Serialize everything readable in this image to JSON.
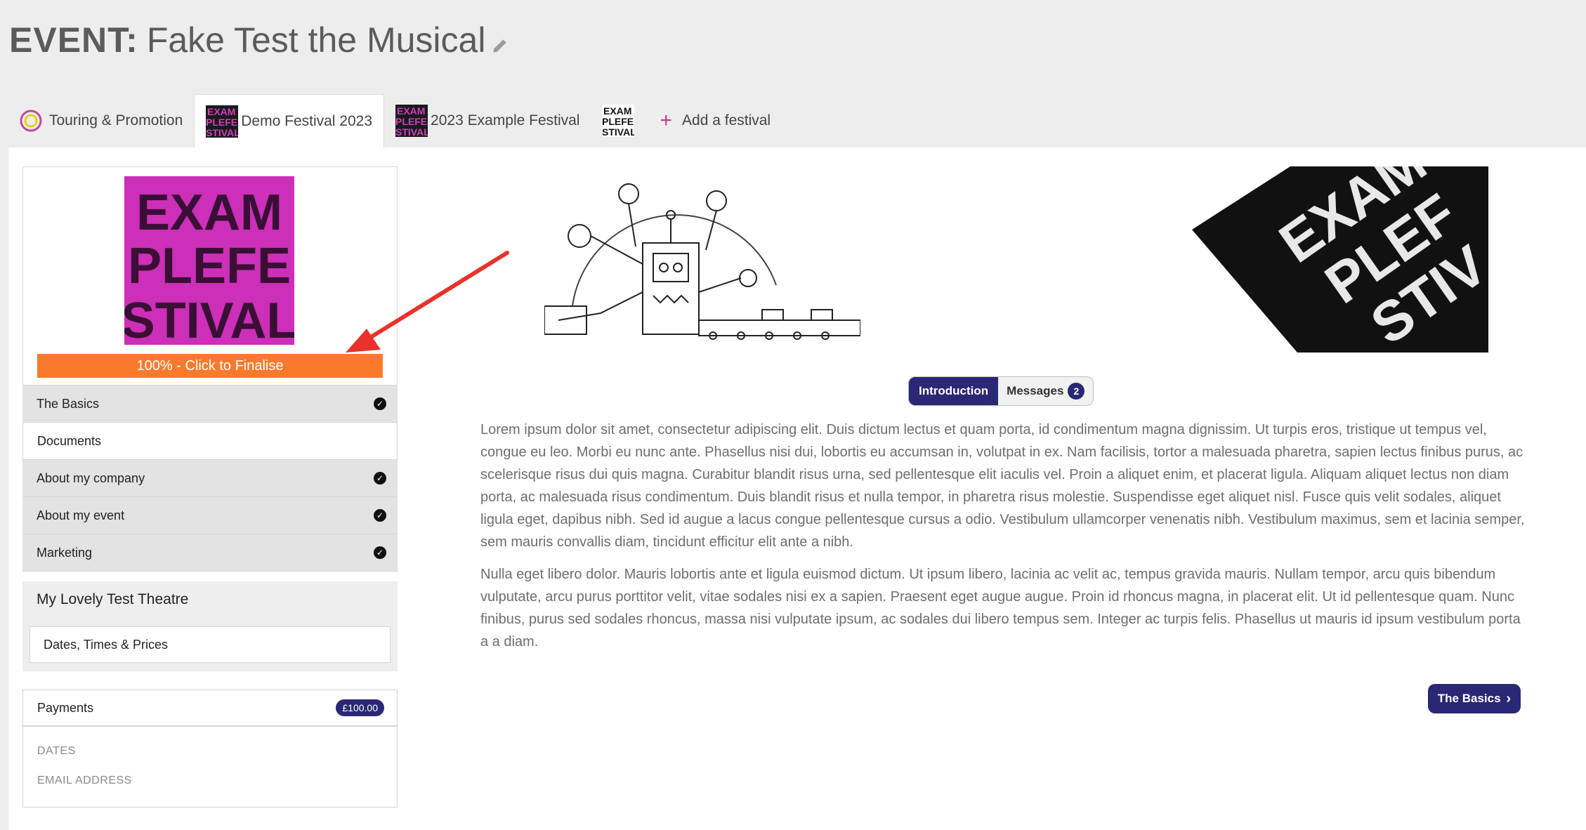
{
  "header": {
    "label": "EVENT:",
    "event_name": "Fake Test the Musical"
  },
  "tabs": [
    {
      "label": "Touring & Promotion",
      "icon": "ring-icon"
    },
    {
      "label": "Demo Festival 2023",
      "icon": "festival-logo-icon",
      "active": true
    },
    {
      "label": "2023 Example Festival",
      "icon": "festival-logo-icon"
    },
    {
      "label": "",
      "icon": "festival-logo-bw-icon"
    },
    {
      "label": "Add a festival",
      "icon": "plus-icon"
    }
  ],
  "sidebar": {
    "logo_text": [
      "EXAM",
      "PLEFE",
      "STIVAL"
    ],
    "progress": {
      "percent": 100,
      "label": "100% - Click to Finalise"
    },
    "menu": [
      {
        "label": "The Basics",
        "complete": true
      },
      {
        "label": "Documents",
        "complete": false
      },
      {
        "label": "About my company",
        "complete": true
      },
      {
        "label": "About my event",
        "complete": true
      },
      {
        "label": "Marketing",
        "complete": true
      }
    ],
    "venue": {
      "title": "My Lovely Test Theatre",
      "button": "Dates, Times & Prices"
    },
    "payments": {
      "label": "Payments",
      "amount": "£100.00",
      "fields": [
        "DATES",
        "EMAIL ADDRESS"
      ]
    }
  },
  "main": {
    "segment": {
      "intro": "Introduction",
      "messages": "Messages",
      "message_count": "2"
    },
    "paragraphs": [
      "Lorem ipsum dolor sit amet, consectetur adipiscing elit. Duis dictum lectus et quam porta, id condimentum magna dignissim. Ut turpis eros, tristique ut tempus vel, congue eu leo. Morbi eu nunc ante. Phasellus nisi dui, lobortis eu accumsan in, volutpat in ex. Nam facilisis, tortor a malesuada pharetra, sapien lectus finibus purus, ac scelerisque risus dui quis magna. Curabitur blandit risus urna, sed pellentesque elit iaculis vel. Proin a aliquet enim, et placerat ligula. Aliquam aliquet lectus non diam porta, ac malesuada risus condimentum. Duis blandit risus et nulla tempor, in pharetra risus molestie. Suspendisse eget aliquet nisl. Fusce quis velit sodales, aliquet ligula eget, dapibus nibh. Sed id augue a lacus congue pellentesque cursus a odio. Vestibulum ullamcorper venenatis nibh. Vestibulum maximus, sem et lacinia semper, sem mauris convallis diam, tincidunt efficitur elit ante a nibh.",
      "Nulla eget libero dolor. Mauris lobortis ante et ligula euismod dictum. Ut ipsum libero, lacinia ac velit ac, tempus gravida mauris. Nullam tempor, arcu quis bibendum vulputate, arcu purus porttitor velit, vitae sodales nisi ex a sapien. Praesent eget augue augue. Proin id rhoncus magna, in placerat elit. Ut id pellentesque quam. Nunc finibus, purus sed sodales rhoncus, massa nisi vulputate ipsum, ac sodales dui libero tempus sem. Integer ac turpis felis. Phasellus ut mauris id ipsum vestibulum porta a a diam."
    ],
    "banner_text": [
      "EXAM",
      "PLEF",
      "STIV"
    ],
    "next_button": "The Basics"
  },
  "colors": {
    "accent": "#2a2774",
    "progress": "#f97a2b",
    "logo_bg": "#cc2fb8",
    "add_icon": "#d0318c"
  }
}
